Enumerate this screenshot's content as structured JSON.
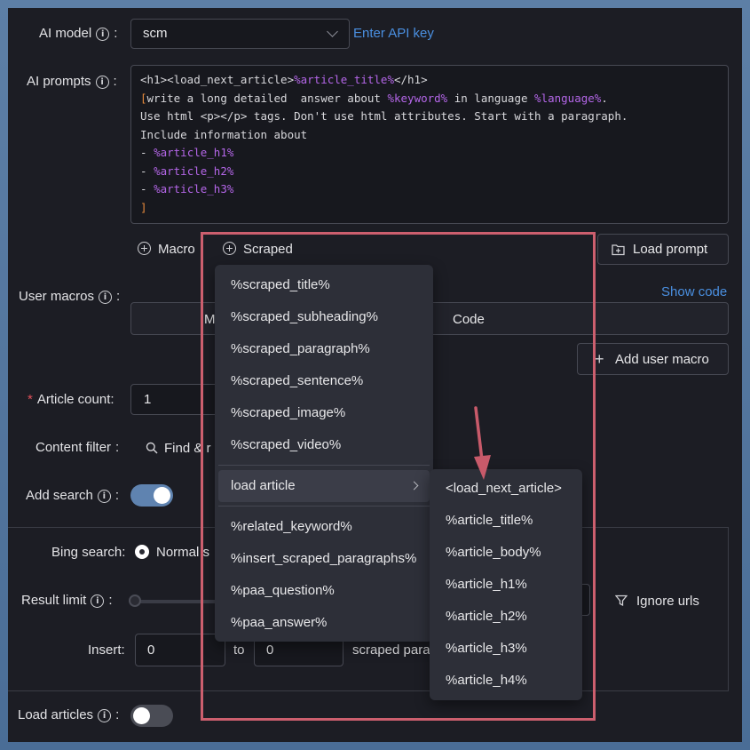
{
  "labels": {
    "ai_model": "AI model",
    "ai_prompts": "AI prompts",
    "user_macros": "User macros",
    "article_count": "Article count",
    "content_filter": "Content filter",
    "add_search": "Add search",
    "bing_search": "Bing search",
    "result_limit": "Result limit",
    "insert": "Insert",
    "load_articles": "Load articles",
    "colon": ":"
  },
  "model": {
    "value": "scm",
    "api_link": "Enter API key"
  },
  "prompt": {
    "l1_open": "<h1><load_next_article>",
    "l1_macro": "%article_title%",
    "l1_close": "</h1>",
    "l2_bracket": "[",
    "l2_a": "write a long detailed  answer about ",
    "l2_macro1": "%keyword%",
    "l2_b": " in language ",
    "l2_macro2": "%language%",
    "l2_c": ".",
    "l3": "Use html <p></p> tags. Don't use html attributes. Start with a paragraph.",
    "l4": "Include information about",
    "l5_dash": "- ",
    "l5_macro": "%article_h1%",
    "l6_dash": "- ",
    "l6_macro": "%article_h2%",
    "l7_dash": "- ",
    "l7_macro": "%article_h3%",
    "l8_bracket": "]"
  },
  "toolbar": {
    "macro": "Macro",
    "scraped": "Scraped",
    "load_prompt": "Load prompt"
  },
  "user_macros": {
    "show_code": "Show code",
    "col_macro": "M",
    "col_code": "Code",
    "add": "Add user macro"
  },
  "article_count": {
    "value": "1"
  },
  "content_filter": {
    "find": "Find & r"
  },
  "search": {
    "bing_option": "Normal s",
    "ignore_urls": "Ignore urls",
    "insert_from": "0",
    "insert_to": "0",
    "to_label": "to",
    "scraped_para": "scraped para"
  },
  "scraped_menu": {
    "items": [
      "%scraped_title%",
      "%scraped_subheading%",
      "%scraped_paragraph%",
      "%scraped_sentence%",
      "%scraped_image%",
      "%scraped_video%"
    ],
    "load_article": "load article",
    "items2": [
      "%related_keyword%",
      "%insert_scraped_paragraphs%",
      "%paa_question%",
      "%paa_answer%"
    ]
  },
  "submenu": {
    "items": [
      "<load_next_article>",
      "%article_title%",
      "%article_body%",
      "%article_h1%",
      "%article_h2%",
      "%article_h3%",
      "%article_h4%"
    ]
  },
  "colors": {
    "accent": "#4a8fe0",
    "macro": "#b466e8",
    "bracket": "#e88b3c",
    "highlight": "#cc5f6e"
  }
}
